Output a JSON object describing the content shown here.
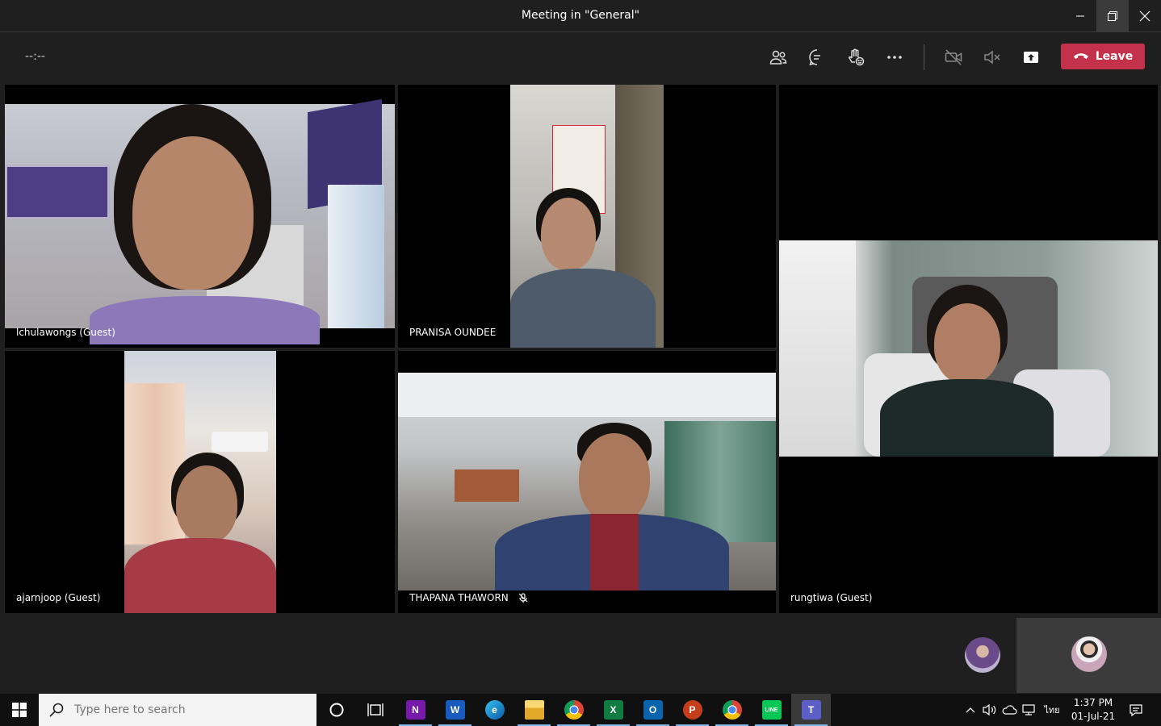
{
  "window": {
    "title": "Meeting in \"General\""
  },
  "toolbar": {
    "timer": "--:--",
    "leave_label": "Leave",
    "icons": [
      "people-icon",
      "chat-icon",
      "reactions-icon",
      "more-icon",
      "camera-off-icon",
      "mic-off-icon",
      "share-icon"
    ]
  },
  "participants": [
    {
      "name": "lchulawongs (Guest)"
    },
    {
      "name": "PRANISA OUNDEE"
    },
    {
      "name": "rungtiwa (Guest)"
    },
    {
      "name": "ajarnjoop (Guest)"
    },
    {
      "name": "THAPANA THAWORN",
      "muted": true
    }
  ],
  "taskbar": {
    "search_placeholder": "Type here to search",
    "apps": [
      {
        "name": "cortana",
        "icon": "circle-icon"
      },
      {
        "name": "task-view",
        "icon": "task-view-icon"
      },
      {
        "name": "onenote",
        "letter": "N",
        "color": "#7719aa"
      },
      {
        "name": "word",
        "letter": "W",
        "color": "#185abd"
      },
      {
        "name": "edge",
        "letter": "e",
        "color": "#0f8fd6"
      },
      {
        "name": "file-explorer",
        "letter": "",
        "color": "#f3c13a"
      },
      {
        "name": "chrome",
        "letter": "",
        "color": "#db4437"
      },
      {
        "name": "excel",
        "letter": "X",
        "color": "#107c41"
      },
      {
        "name": "outlook",
        "letter": "O",
        "color": "#0a64ad"
      },
      {
        "name": "powerpoint",
        "letter": "P",
        "color": "#c43e1c"
      },
      {
        "name": "chrome-2",
        "letter": "",
        "color": "#db4437"
      },
      {
        "name": "line",
        "letter": "LINE",
        "color": "#06c755"
      },
      {
        "name": "teams",
        "letter": "T",
        "color": "#5b5fc7"
      }
    ],
    "language": "ไทย",
    "time": "1:37 PM",
    "date": "01-Jul-21"
  },
  "colors": {
    "leave": "#c4314b",
    "accent": "#5b5fc7"
  }
}
